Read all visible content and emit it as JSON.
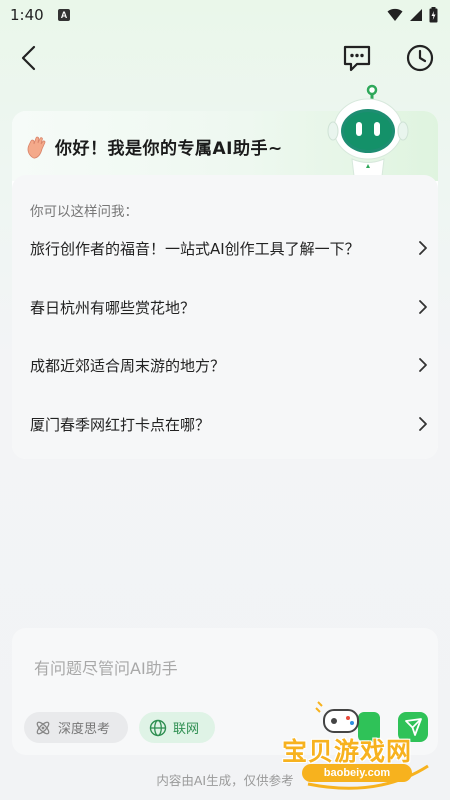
{
  "status_bar": {
    "time": "1:40",
    "notification_badge": "A"
  },
  "header": {
    "back_icon": "chevron-left-icon",
    "message_icon": "chat-bubble-dots-icon",
    "history_icon": "clock-history-icon"
  },
  "greeting": {
    "title": "你好！我是你的专属AI助手~",
    "wave_icon": "waving-hand-icon",
    "mascot": "robot-mascot-icon"
  },
  "suggestions": {
    "hint": "你可以这样问我：",
    "items": [
      {
        "text": "旅行创作者的福音！一站式AI创作工具了解一下？"
      },
      {
        "text": "春日杭州有哪些赏花地？"
      },
      {
        "text": "成都近郊适合周末游的地方？"
      },
      {
        "text": "厦门春季网红打卡点在哪？"
      }
    ]
  },
  "input": {
    "placeholder": "有问题尽管问AI助手",
    "deep_think_label": "深度思考",
    "web_label": "联网"
  },
  "footer": {
    "note": "内容由AI生成，仅供参考"
  },
  "watermark": {
    "text": "宝贝游戏网",
    "url": "baobeiy.com"
  },
  "colors": {
    "accent_green": "#2fc258",
    "chip_web_bg": "#dff3e6",
    "watermark_orange": "#f7b21e"
  }
}
